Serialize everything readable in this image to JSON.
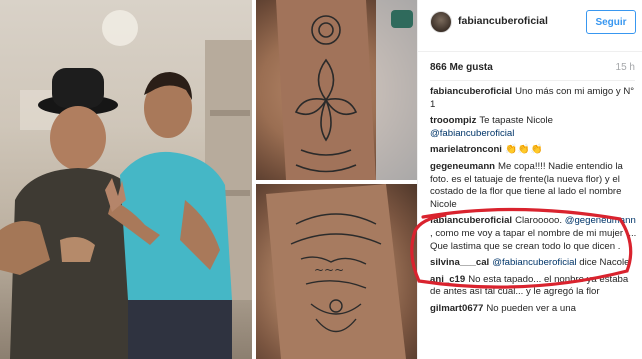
{
  "post": {
    "username": "fabiancuberoficial",
    "follow_label": "Seguir",
    "likes": "866 Me gusta",
    "time": "15 h"
  },
  "photos": [
    {
      "id": "main",
      "subject": "two-men-portrait"
    },
    {
      "id": "arm-top",
      "subject": "flower-tattoo-forearm"
    },
    {
      "id": "arm-bottom",
      "subject": "mandala-tattoo-forearm"
    }
  ],
  "comments": [
    {
      "user": "fabiancuberoficial",
      "parts": [
        {
          "t": "Uno más con mi amigo y N° 1"
        }
      ]
    },
    {
      "user": "trooompiz",
      "parts": [
        {
          "t": "Te tapaste Nicole "
        },
        {
          "m": "@fabiancuberoficial"
        }
      ]
    },
    {
      "user": "marielatronconi",
      "parts": [
        {
          "e": "👏👏👏"
        }
      ]
    },
    {
      "user": "gegeneumann",
      "parts": [
        {
          "t": "Me copa!!!! Nadie entendio la foto. es el tatuaje de frente(la nueva flor) y el costado de la flor que tiene al lado el nombre Nicole"
        }
      ]
    },
    {
      "user": "fabiancuberoficial",
      "parts": [
        {
          "t": "Clarooooo. "
        },
        {
          "m": "@gegeneumann"
        },
        {
          "t": " , como me voy a tapar el nombre de mi mujer .... Que lastima que se crean todo lo que dicen ."
        }
      ]
    },
    {
      "user": "silvina___cal",
      "parts": [
        {
          "m": "@fabiancuberoficial"
        },
        {
          "t": " dice Nacole"
        }
      ]
    },
    {
      "user": "ani_c19",
      "parts": [
        {
          "t": "No esta tapado... el nonbre ya estaba de antes así tal cual... y le agregó la flor"
        }
      ]
    },
    {
      "user": "gilmart0677",
      "parts": [
        {
          "t": "No pueden ver a una"
        }
      ]
    }
  ],
  "colors": {
    "accent": "#3897f0",
    "mention": "#003569",
    "highlight": "#d9232e"
  },
  "icons": {
    "avatar": "profile-avatar",
    "annotation": "red-ellipse-highlight"
  }
}
